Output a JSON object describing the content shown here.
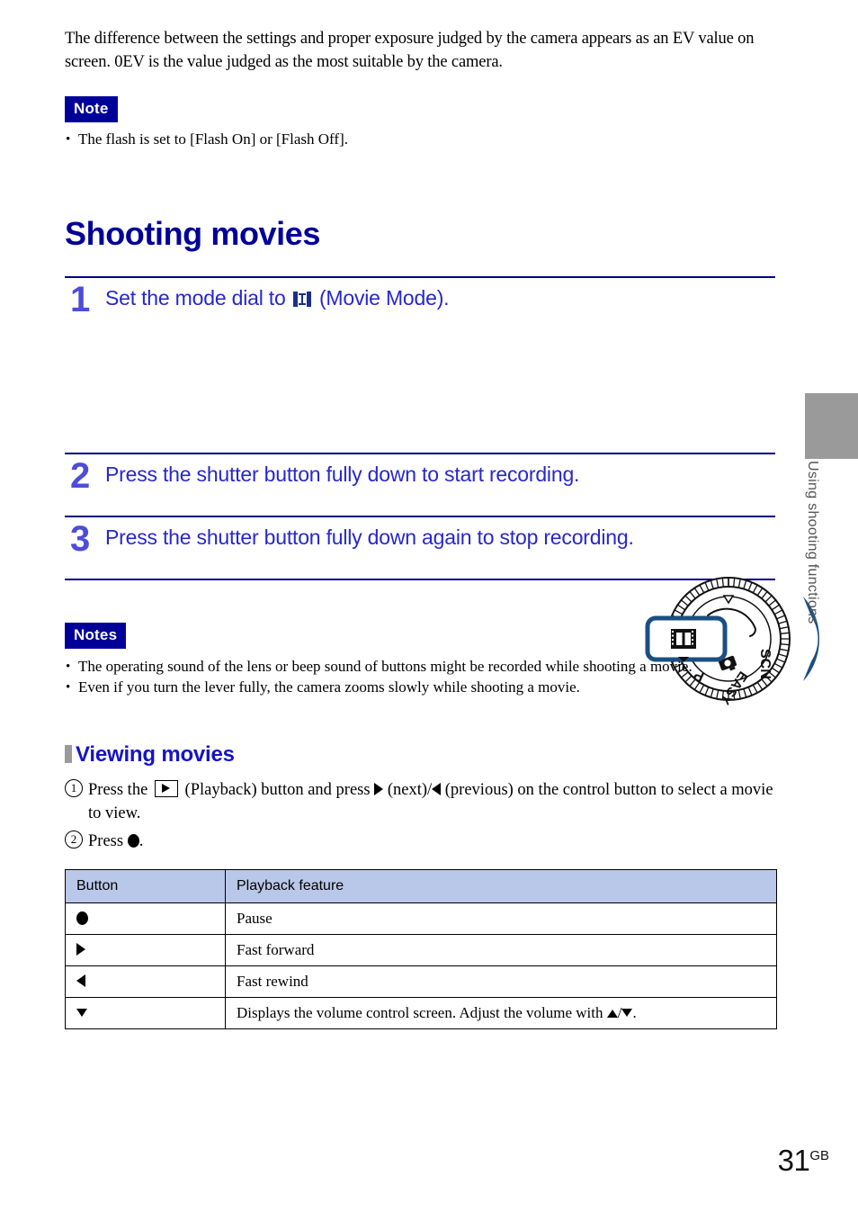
{
  "intro": {
    "paragraph": "The difference between the settings and proper exposure judged by the camera appears as an EV value on screen. 0EV is the value judged as the most suitable by the camera."
  },
  "note_block": {
    "badge": "Note",
    "items": [
      "The flash is set to [Flash On] or [Flash Off]."
    ]
  },
  "section": {
    "title": "Shooting movies"
  },
  "steps": [
    {
      "number": "1",
      "text_before_icon": "Set the mode dial to ",
      "icon": "movie-mode-film-icon",
      "text_after_icon": " (Movie Mode)."
    },
    {
      "number": "2",
      "text": "Press the shutter button fully down to start recording."
    },
    {
      "number": "3",
      "text": "Press the shutter button fully down again to stop recording."
    }
  ],
  "dial_figure": {
    "name": "mode-dial-illustration",
    "labels": [
      "SCN",
      "EASY",
      "P"
    ],
    "callout_icon": "movie-mode-film-icon",
    "rotation_arrow": "double-headed-curved-arrow"
  },
  "notes_block": {
    "badge": "Notes",
    "items": [
      "The operating sound of the lens or beep sound of buttons might be recorded while shooting a movie.",
      "Even if you turn the lever fully, the camera zooms slowly while shooting a movie."
    ]
  },
  "subsection": {
    "title": "Viewing movies"
  },
  "procedure": [
    {
      "number": "1",
      "part1": "Press the ",
      "icon": "playback-button-icon",
      "part2": " (Playback) button and press ",
      "arrow_next": "triangle-right-icon",
      "part3": " (next)/",
      "arrow_prev": "triangle-left-icon",
      "part4": " (previous) on the control button to select a movie to view."
    },
    {
      "number": "2",
      "part1": "Press ",
      "icon": "center-button-dot-icon",
      "part2": "."
    }
  ],
  "table": {
    "headers": [
      "Button",
      "Playback feature"
    ],
    "rows": [
      {
        "button_icon": "center-button-dot-icon",
        "feature": "Pause"
      },
      {
        "button_icon": "triangle-right-icon",
        "feature": "Fast forward"
      },
      {
        "button_icon": "triangle-left-icon",
        "feature": "Fast rewind"
      },
      {
        "button_icon": "triangle-down-icon",
        "feature_part1": "Displays the volume control screen. Adjust the volume with ",
        "feature_icon_up": "triangle-up-icon",
        "feature_sep": "/",
        "feature_icon_down": "triangle-down-icon",
        "feature_part2": "."
      }
    ]
  },
  "edge_tab": {
    "label": "Using shooting functions"
  },
  "footer": {
    "page_number": "31",
    "page_suffix": "GB"
  },
  "colors": {
    "heading_blue": "#000099",
    "step_blue": "#2727cc",
    "step_number_blue": "#4d4dd8",
    "badge_bg": "#000099",
    "table_header_bg": "#b9c7e8",
    "tab_gray": "#9a9a9a",
    "rule_navy": "#000080"
  }
}
